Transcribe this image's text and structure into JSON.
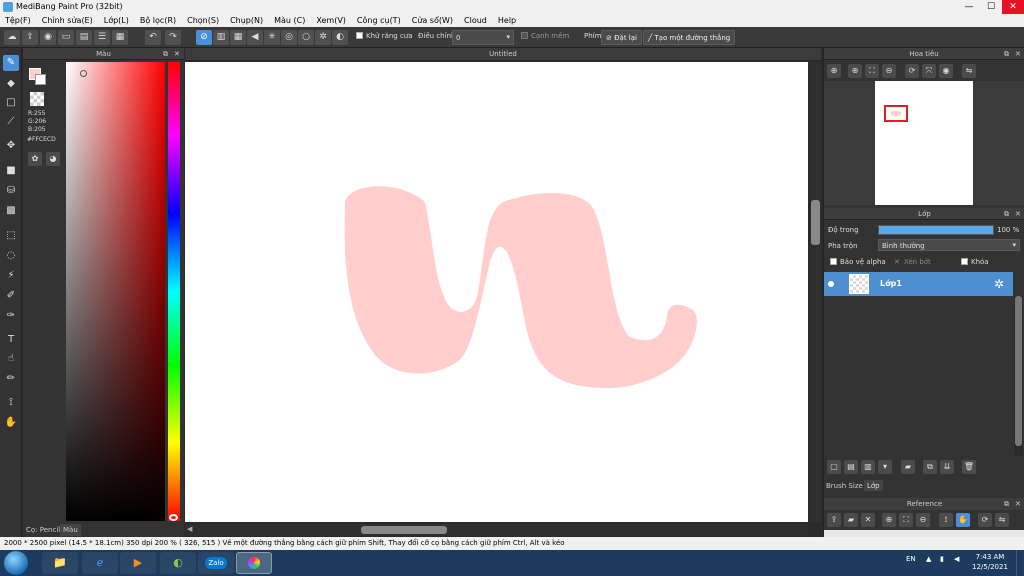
{
  "window": {
    "title": "MediBang Paint Pro (32bit)",
    "minimize": "—",
    "maximize": "☐",
    "close": "✕"
  },
  "menu": [
    "Tệp(F)",
    "Chỉnh sửa(E)",
    "Lớp(L)",
    "Bộ lọc(R)",
    "Chọn(S)",
    "Chụp(N)",
    "Màu (C)",
    "Xem(V)",
    "Công cụ(T)",
    "Cửa sổ(W)",
    "Cloud",
    "Help"
  ],
  "toolbar": {
    "antialias_label": "Khử răng cưa",
    "adjust_label": "Điều chỉnh",
    "adjust_value": "0",
    "edge_label": "Cạnh mềm",
    "key_label": "Phím",
    "reset_label": "Đặt lại",
    "line_label": "Tạo một đường thẳng"
  },
  "color_panel": {
    "title": "Màu",
    "r": "R:255",
    "g": "G:206",
    "b": "B:205",
    "hex": "#FFCECD",
    "tab_pencil": "Cọ: Pencil",
    "tab_color": "Màu",
    "primary_color": "#FFCECD"
  },
  "canvas": {
    "doc_title": "Untitled",
    "stroke_color": "#FFCECD"
  },
  "navigator": {
    "title": "Hoa tiêu"
  },
  "layer_panel": {
    "title": "Lớp",
    "opacity_label": "Độ trong",
    "opacity_value": "100 %",
    "opacity_fraction": 1.0,
    "blend_label": "Pha trộn",
    "blend_value": "Bình thường",
    "protect_alpha": "Bảo vệ alpha",
    "clipping": "Xén bớt",
    "lock": "Khóa",
    "layer_name": "Lớp1",
    "tab_brush_size": "Brush Size",
    "tab_layer": "Lớp"
  },
  "reference": {
    "title": "Reference"
  },
  "status": {
    "text": "2000 * 2500 pixel   (14.5 * 18.1cm)   350 dpi   200 %   ( 326, 515 )   Vẽ một đường thẳng bằng cách giữ phím Shift, Thay đổi cỡ cọ bằng cách giữ phím Ctrl, Alt và kéo"
  },
  "taskbar": {
    "zalo_label": "Zalo",
    "lang": "EN",
    "time": "7:43 AM",
    "date": "12/5/2021"
  }
}
